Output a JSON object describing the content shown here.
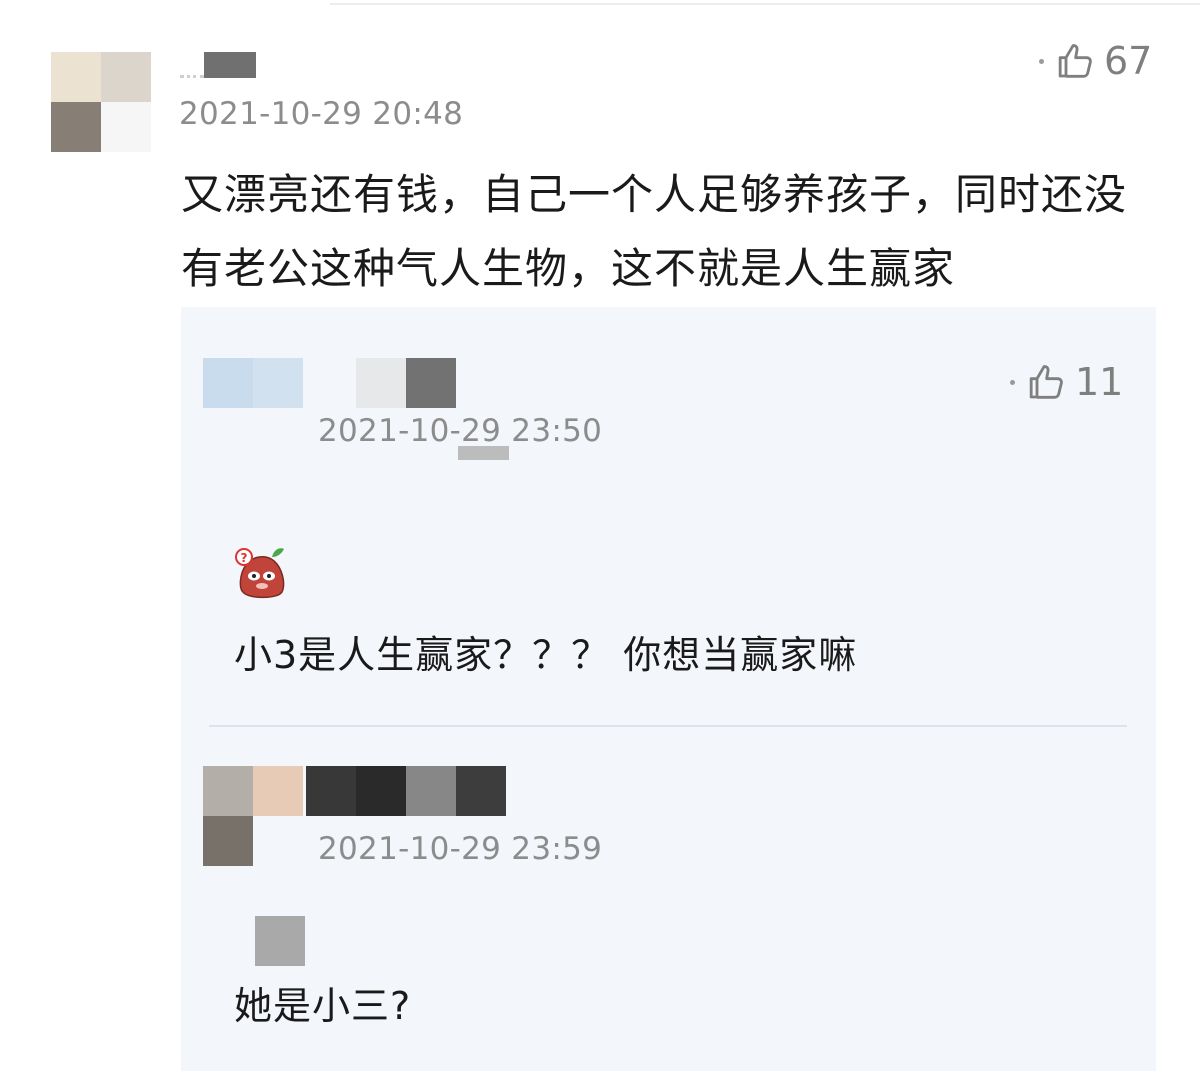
{
  "comment": {
    "timestamp": "2021-10-29 20:48",
    "like_icon": "thumbs-up-icon",
    "like_count": "67",
    "text": "又漂亮还有钱，自己一个人足够养孩子，同时还没有老公这种气人生物，这不就是人生赢家"
  },
  "replies": [
    {
      "timestamp": "2021-10-29 23:50",
      "like_icon": "thumbs-up-icon",
      "like_count": "11",
      "sticker": "confused-potato-sticker",
      "text": "小3是人生赢家？？？ 你想当赢家嘛"
    },
    {
      "timestamp": "2021-10-29 23:59",
      "text": "她是小三?"
    }
  ],
  "colors": {
    "timestamp": "#8c8c8c",
    "reply_background": "#f3f6fa",
    "text": "#1a1a1a"
  }
}
